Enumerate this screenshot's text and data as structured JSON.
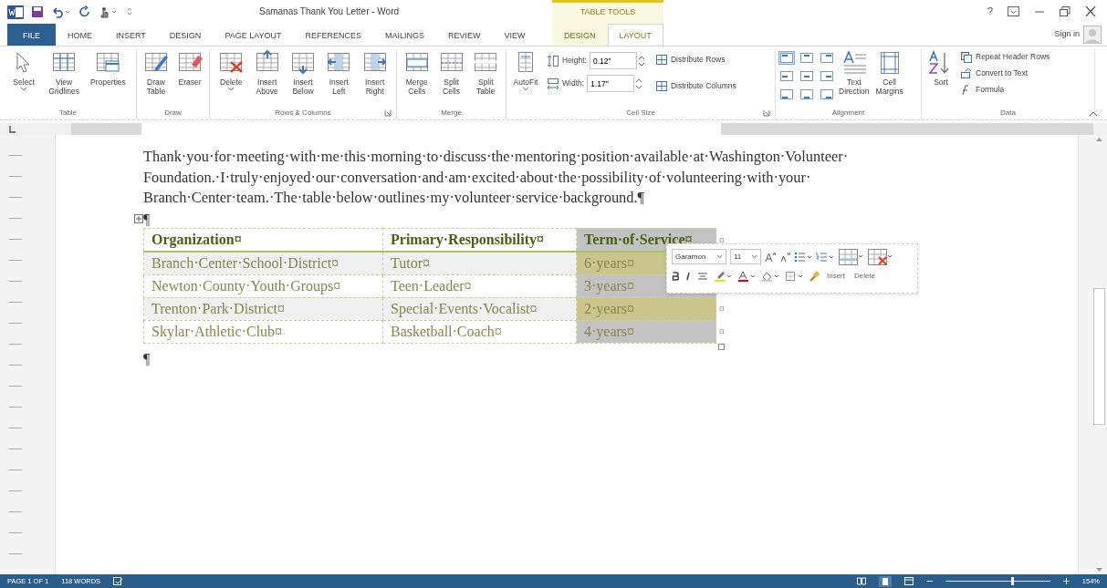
{
  "window": {
    "title": "Samanas Thank You Letter - Word",
    "context_label": "TABLE TOOLS",
    "help": "?"
  },
  "tabs": [
    {
      "label": "FILE",
      "selected": false,
      "kind": "file"
    },
    {
      "label": "HOME",
      "selected": false
    },
    {
      "label": "INSERT",
      "selected": false
    },
    {
      "label": "DESIGN",
      "selected": false
    },
    {
      "label": "PAGE LAYOUT",
      "selected": false
    },
    {
      "label": "REFERENCES",
      "selected": false
    },
    {
      "label": "MAILINGS",
      "selected": false
    },
    {
      "label": "REVIEW",
      "selected": false
    },
    {
      "label": "VIEW",
      "selected": false
    },
    {
      "label": "DESIGN",
      "selected": false,
      "contextual": true
    },
    {
      "label": "LAYOUT",
      "selected": true,
      "contextual": true
    }
  ],
  "account": {
    "label": "Sign in"
  },
  "ribbon": {
    "groups": [
      {
        "label": "Table",
        "buttons": [
          {
            "label": "Select",
            "dropdown": true
          },
          {
            "label": "View Gridlines"
          },
          {
            "label": "Properties"
          }
        ]
      },
      {
        "label": "Draw",
        "buttons": [
          {
            "label": "Draw Table"
          },
          {
            "label": "Eraser"
          }
        ]
      },
      {
        "label": "Rows & Columns",
        "launcher": true,
        "buttons": [
          {
            "label": "Delete",
            "dropdown": true
          },
          {
            "label": "Insert Above"
          },
          {
            "label": "Insert Below"
          },
          {
            "label": "Insert Left"
          },
          {
            "label": "Insert Right"
          }
        ]
      },
      {
        "label": "Merge",
        "buttons": [
          {
            "label": "Merge Cells"
          },
          {
            "label": "Split Cells"
          },
          {
            "label": "Split Table"
          }
        ]
      },
      {
        "label": "Cell Size",
        "launcher": true,
        "kind": "cell_size",
        "buttons": [
          {
            "label": "AutoFit",
            "dropdown": true
          }
        ],
        "fields": [
          {
            "label": "Height:",
            "value": "0.12\""
          },
          {
            "label": "Width:",
            "value": "1.17\""
          }
        ],
        "commands": [
          "Distribute Rows",
          "Distribute Columns"
        ]
      },
      {
        "label": "Alignment",
        "kind": "alignment",
        "align_buttons": [
          {
            "selected": true
          },
          {
            "selected": false
          },
          {
            "selected": false
          },
          {
            "selected": false
          },
          {
            "selected": false
          },
          {
            "selected": false
          },
          {
            "selected": false
          },
          {
            "selected": false
          },
          {
            "selected": false
          }
        ],
        "buttons": [
          {
            "label": "Text Direction"
          },
          {
            "label": "Cell Margins"
          }
        ]
      },
      {
        "label": "Data",
        "kind": "data",
        "buttons": [
          {
            "label": "Sort"
          }
        ],
        "commands": [
          "Repeat Header Rows",
          "Convert to Text",
          "Formula"
        ]
      }
    ]
  },
  "document": {
    "paragraph_lines": [
      "Thank·you·for·meeting·with·me·this·morning·to·discuss·the·mentoring·position·available·at·Washington·Volunteer·",
      "Foundation.·I·truly·enjoyed·our·conversation·and·am·excited·about·the·possibility·of·volunteering·with·your·",
      "Branch·Center·team.·The·table·below·outlines·my·volunteer·service·background.¶"
    ],
    "mark_before_table": "¶",
    "table": {
      "columns": [
        {
          "header": "Organization¤",
          "selected": false
        },
        {
          "header": "Primary·Responsibility¤",
          "selected": false
        },
        {
          "header": "Term·of·Service¤",
          "selected": true
        }
      ],
      "header_end_mark": "¤",
      "rows": [
        {
          "cells": [
            "Branch·Center·School·District¤",
            "Tutor¤",
            "6·years¤"
          ]
        },
        {
          "cells": [
            "Newton·County·Youth·Groups¤",
            "Teen·Leader¤",
            "3·years¤"
          ]
        },
        {
          "cells": [
            "Trenton·Park·District¤",
            "Special·Events·Vocalist¤",
            "2·years¤"
          ],
          "end_mark": "¤"
        },
        {
          "cells": [
            "Skylar·Athletic·Club¤",
            "Basketball·Coach¤",
            "4·years¤"
          ],
          "end_mark": "¤"
        }
      ]
    },
    "mark_after_table": "¶",
    "mini_toolbar": {
      "font": "Garamon",
      "size": "11",
      "buttons": [
        "Insert",
        "Delete"
      ]
    }
  },
  "status_bar": {
    "page": "PAGE 1 OF 1",
    "words": "118 WORDS",
    "zoom": "154%",
    "level": 0.64
  }
}
